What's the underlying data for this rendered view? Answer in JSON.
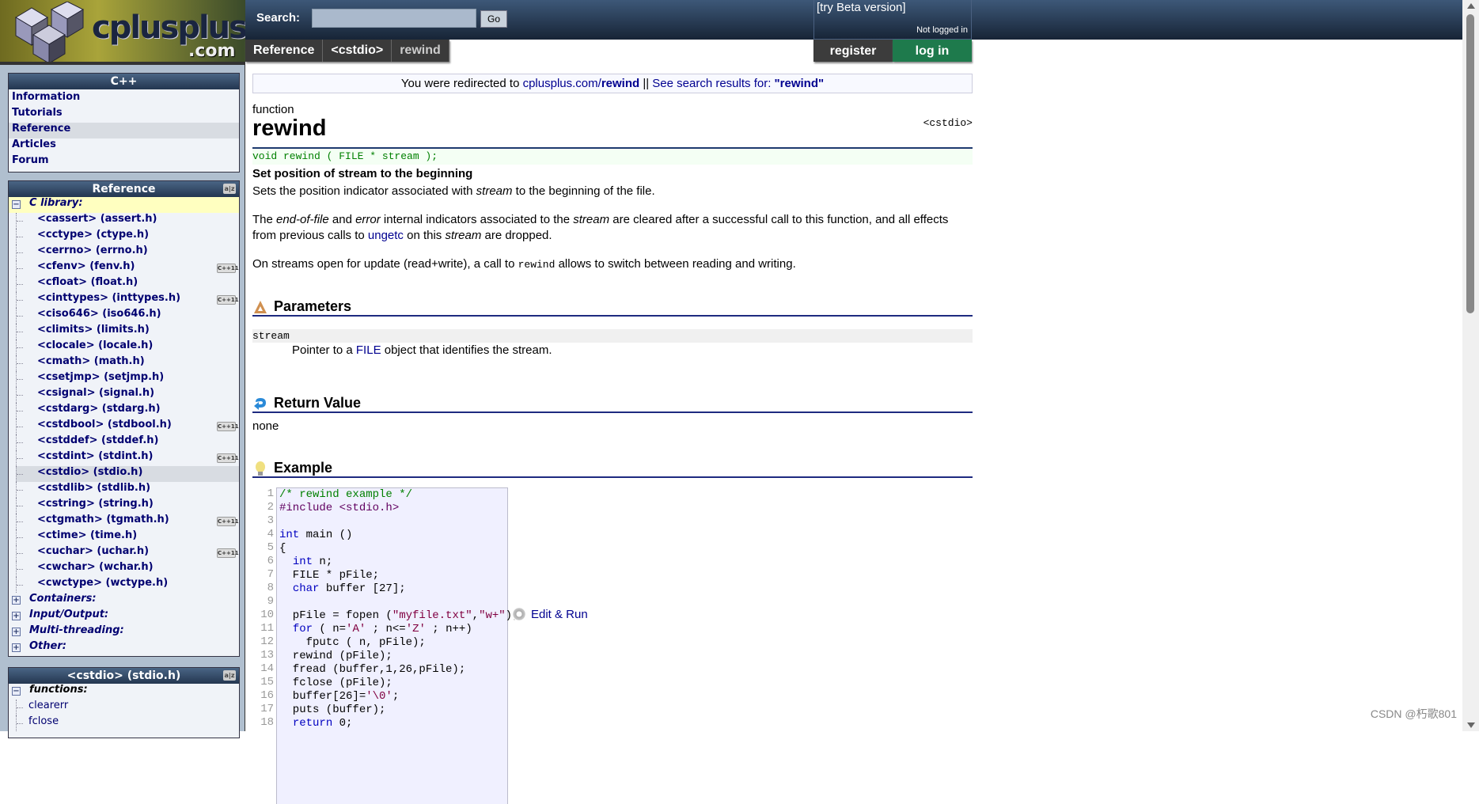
{
  "header": {
    "logo_text": "cplusplus",
    "logo_suffix": ".com",
    "search_label": "Search:",
    "search_value": "",
    "go_label": "Go",
    "beta_link": "[try Beta version]",
    "login_status": "Not logged in",
    "register": "register",
    "login": "log in"
  },
  "breadcrumb": [
    "Reference",
    "<cstdio>",
    "rewind"
  ],
  "sidebar": {
    "cpp_box": {
      "title": "C++",
      "items": [
        "Information",
        "Tutorials",
        "Reference",
        "Articles",
        "Forum"
      ],
      "selected": "Reference"
    },
    "reference_box": {
      "title": "Reference",
      "category_open": "C library:",
      "headers": [
        {
          "label": "<cassert> (assert.h)",
          "cpp11": false
        },
        {
          "label": "<cctype> (ctype.h)",
          "cpp11": false
        },
        {
          "label": "<cerrno> (errno.h)",
          "cpp11": false
        },
        {
          "label": "<cfenv> (fenv.h)",
          "cpp11": true
        },
        {
          "label": "<cfloat> (float.h)",
          "cpp11": false
        },
        {
          "label": "<cinttypes> (inttypes.h)",
          "cpp11": true
        },
        {
          "label": "<ciso646> (iso646.h)",
          "cpp11": false
        },
        {
          "label": "<climits> (limits.h)",
          "cpp11": false
        },
        {
          "label": "<clocale> (locale.h)",
          "cpp11": false
        },
        {
          "label": "<cmath> (math.h)",
          "cpp11": false
        },
        {
          "label": "<csetjmp> (setjmp.h)",
          "cpp11": false
        },
        {
          "label": "<csignal> (signal.h)",
          "cpp11": false
        },
        {
          "label": "<cstdarg> (stdarg.h)",
          "cpp11": false
        },
        {
          "label": "<cstdbool> (stdbool.h)",
          "cpp11": true
        },
        {
          "label": "<cstddef> (stddef.h)",
          "cpp11": false
        },
        {
          "label": "<cstdint> (stdint.h)",
          "cpp11": true
        },
        {
          "label": "<cstdio> (stdio.h)",
          "cpp11": false,
          "selected": true
        },
        {
          "label": "<cstdlib> (stdlib.h)",
          "cpp11": false
        },
        {
          "label": "<cstring> (string.h)",
          "cpp11": false
        },
        {
          "label": "<ctgmath> (tgmath.h)",
          "cpp11": true
        },
        {
          "label": "<ctime> (time.h)",
          "cpp11": false
        },
        {
          "label": "<cuchar> (uchar.h)",
          "cpp11": true
        },
        {
          "label": "<cwchar> (wchar.h)",
          "cpp11": false
        },
        {
          "label": "<cwctype> (wctype.h)",
          "cpp11": false
        }
      ],
      "cpp11_badge": "C++11",
      "categories_closed": [
        "Containers:",
        "Input/Output:",
        "Multi-threading:",
        "Other:"
      ]
    },
    "cstdio_box": {
      "title": "<cstdio> (stdio.h)",
      "category_open": "functions:",
      "items": [
        "clearerr",
        "fclose"
      ]
    }
  },
  "main": {
    "redirect": {
      "prefix": "You were redirected to ",
      "link_host": "cplusplus.com/",
      "link_page": "rewind",
      "sep": " || ",
      "search_link": "See search results for: ",
      "query": "\"rewind\""
    },
    "kind": "function",
    "title": "rewind",
    "header_file": "<cstdio>",
    "prototype": "void rewind ( FILE * stream );",
    "summary": "Set position of stream to the beginning",
    "p1": [
      "Sets the position indicator associated with ",
      "stream",
      " to the beginning of the file."
    ],
    "p2": [
      "The ",
      "end-of-file",
      " and ",
      "error",
      " internal indicators associated to the ",
      "stream",
      " are cleared after a successful call to this function, and all effects from previous calls to ",
      "ungetc",
      " on this ",
      "stream",
      " are dropped."
    ],
    "p3": [
      "On streams open for update (read+write), a call to ",
      "rewind",
      " allows to switch between reading and writing."
    ],
    "params_title": "Parameters",
    "param_name": "stream",
    "param_desc": [
      "Pointer to a ",
      "FILE",
      " object that identifies the stream."
    ],
    "return_title": "Return Value",
    "return_value": "none",
    "example_title": "Example",
    "edit_run": "Edit & Run",
    "code_lines": [
      "/* rewind example */",
      "#include <stdio.h>",
      "",
      "int main ()",
      "{",
      "  int n;",
      "  FILE * pFile;",
      "  char buffer [27];",
      "",
      "  pFile = fopen (\"myfile.txt\",\"w+\");",
      "  for ( n='A' ; n<='Z' ; n++)",
      "    fputc ( n, pFile);",
      "  rewind (pFile);",
      "  fread (buffer,1,26,pFile);",
      "  fclose (pFile);",
      "  buffer[26]='\\0';",
      "  puts (buffer);",
      "  return 0;"
    ]
  },
  "watermark": "CSDN @朽歌801",
  "colors": {
    "header": "#233650",
    "link": "#000090",
    "login": "#1e7a4c",
    "code_bg": "#f0f0ff",
    "prototype": "#008000"
  }
}
